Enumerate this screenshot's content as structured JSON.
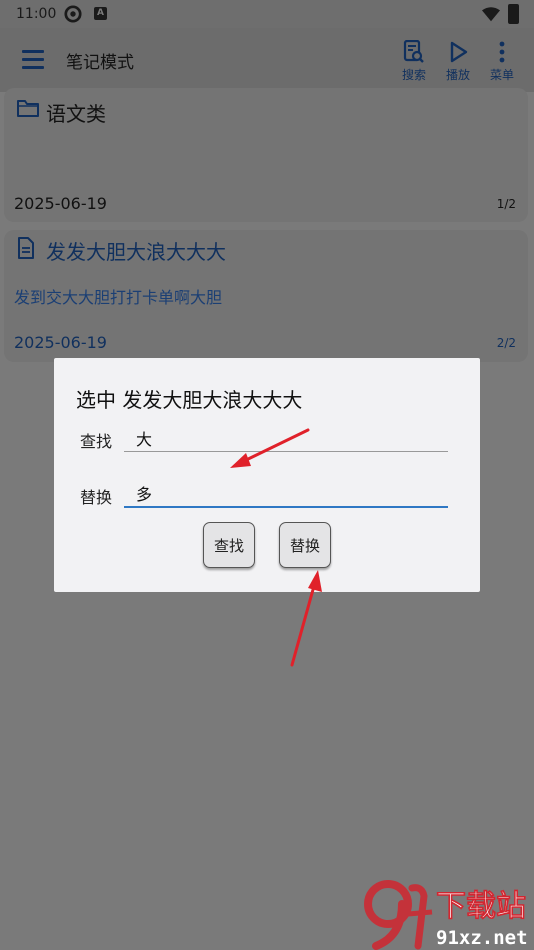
{
  "status_bar": {
    "time": "11:00",
    "badge": "A"
  },
  "app_bar": {
    "title": "笔记模式",
    "actions": [
      {
        "label": "搜索",
        "icon": "search-doc-icon"
      },
      {
        "label": "播放",
        "icon": "play-icon"
      },
      {
        "label": "菜单",
        "icon": "more-vert-icon"
      }
    ]
  },
  "cards": [
    {
      "title": "语文类",
      "icon": "folder-icon",
      "preview": "",
      "date": "2025-06-19",
      "count": "1/2"
    },
    {
      "title": "发发大胆大浪大大大",
      "icon": "document-icon",
      "preview": "发到交大大胆打打卡单啊大胆",
      "date": "2025-06-19",
      "count": "2/2"
    }
  ],
  "dialog": {
    "title": "选中 发发大胆大浪大大大",
    "find_label": "查找",
    "find_value": "大",
    "replace_label": "替换",
    "replace_value": "多",
    "find_button": "查找",
    "replace_button": "替换"
  },
  "watermark": {
    "text": "下载站",
    "domain": "91xz.net",
    "logo": "9f"
  },
  "colors": {
    "accent_blue": "#10305e",
    "link_blue": "#1b3f74",
    "input_focus": "#2f78c4",
    "annotation_red": "#e0212a"
  }
}
